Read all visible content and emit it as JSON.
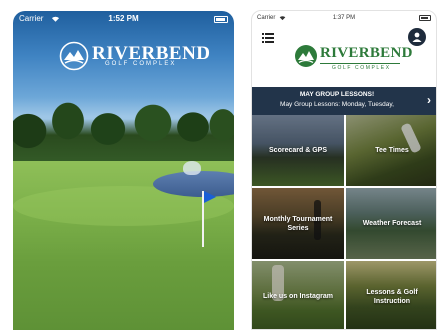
{
  "left_screen": {
    "status_bar": {
      "carrier": "Carrier",
      "time": "1:52 PM"
    },
    "logo": {
      "name": "RIVERBEND",
      "subtitle": "GOLF COMPLEX"
    }
  },
  "right_screen": {
    "status_bar": {
      "carrier": "Carrier",
      "time": "1:37 PM"
    },
    "logo": {
      "name": "RIVERBEND",
      "subtitle": "GOLF COMPLEX"
    },
    "banner": {
      "title": "MAY GROUP LESSONS!",
      "message": "May Group Lessons: Monday, Tuesday,"
    },
    "tiles": [
      {
        "label": "Scorecard & GPS"
      },
      {
        "label": "Tee Times"
      },
      {
        "label": "Monthly Tournament Series"
      },
      {
        "label": "Weather Forecast"
      },
      {
        "label": "Like us on Instagram"
      },
      {
        "label": "Lessons & Golf Instruction"
      }
    ]
  },
  "colors": {
    "brand_green": "#2d7a3a",
    "banner_navy": "#22344a",
    "flag_blue": "#1a5fd6"
  },
  "icons": [
    "wifi-icon",
    "battery-icon",
    "hamburger-menu-icon",
    "profile-icon",
    "chevron-right-icon",
    "riverbend-emblem-icon"
  ]
}
